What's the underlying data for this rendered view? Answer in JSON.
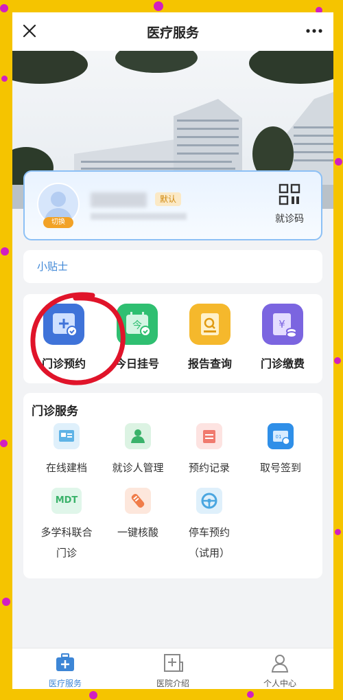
{
  "header": {
    "title": "医疗服务"
  },
  "patient_card": {
    "switch_label": "切换",
    "default_tag": "默认",
    "qr_label": "就诊码"
  },
  "tips": {
    "label": "小贴士"
  },
  "quick_actions": [
    {
      "label": "门诊预约",
      "icon": "appointment-icon",
      "color": "#3f73d9"
    },
    {
      "label": "今日挂号",
      "icon": "calendar-today-icon",
      "color": "#2fbf71"
    },
    {
      "label": "报告查询",
      "icon": "report-search-icon",
      "color": "#f5b82c"
    },
    {
      "label": "门诊缴费",
      "icon": "payment-icon",
      "color": "#7b65e0"
    }
  ],
  "outpatient_services": {
    "title": "门诊服务",
    "items": [
      {
        "label": "在线建档",
        "icon": "id-card-icon"
      },
      {
        "label": "就诊人管理",
        "icon": "patient-manage-icon"
      },
      {
        "label": "预约记录",
        "icon": "record-icon"
      },
      {
        "label": "取号签到",
        "icon": "ticket-checkin-icon"
      },
      {
        "label": "多学科联合",
        "label2": "门诊",
        "icon": "mdt-icon",
        "icon_text": "MDT"
      },
      {
        "label": "一键核酸",
        "icon": "swab-test-icon"
      },
      {
        "label": "停车预约",
        "label2": "（试用）",
        "icon": "parking-icon"
      }
    ]
  },
  "tabbar": [
    {
      "label": "医疗服务",
      "icon": "medical-kit-icon",
      "active": true
    },
    {
      "label": "医院介绍",
      "icon": "hospital-icon",
      "active": false
    },
    {
      "label": "个人中心",
      "icon": "person-icon",
      "active": false
    }
  ],
  "colors": {
    "accent": "#3d86d6",
    "page_bg": "#f5c400",
    "highlight": "#e0142a"
  }
}
